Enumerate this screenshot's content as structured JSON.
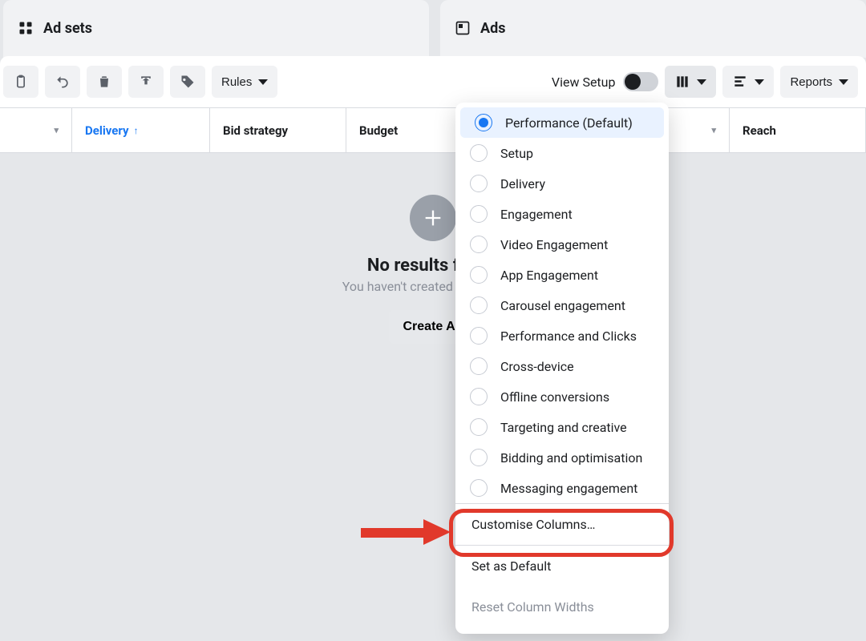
{
  "tabs": {
    "adsets": "Ad sets",
    "ads": "Ads"
  },
  "toolbar": {
    "rules": "Rules",
    "view_setup": "View Setup",
    "reports": "Reports"
  },
  "columns": {
    "delivery": "Delivery",
    "bid_strategy": "Bid strategy",
    "budget": "Budget",
    "reach": "Reach"
  },
  "empty_state": {
    "title": "No results found",
    "subtitle": "You haven't created any ads yet.",
    "cta": "Create Ad"
  },
  "column_presets": [
    "Performance (Default)",
    "Setup",
    "Delivery",
    "Engagement",
    "Video Engagement",
    "App Engagement",
    "Carousel engagement",
    "Performance and Clicks",
    "Cross-device",
    "Offline conversions",
    "Targeting and creative",
    "Bidding and optimisation",
    "Messaging engagement"
  ],
  "column_actions": {
    "customise": "Customise Columns…",
    "set_default": "Set as Default",
    "reset_widths": "Reset Column Widths"
  }
}
